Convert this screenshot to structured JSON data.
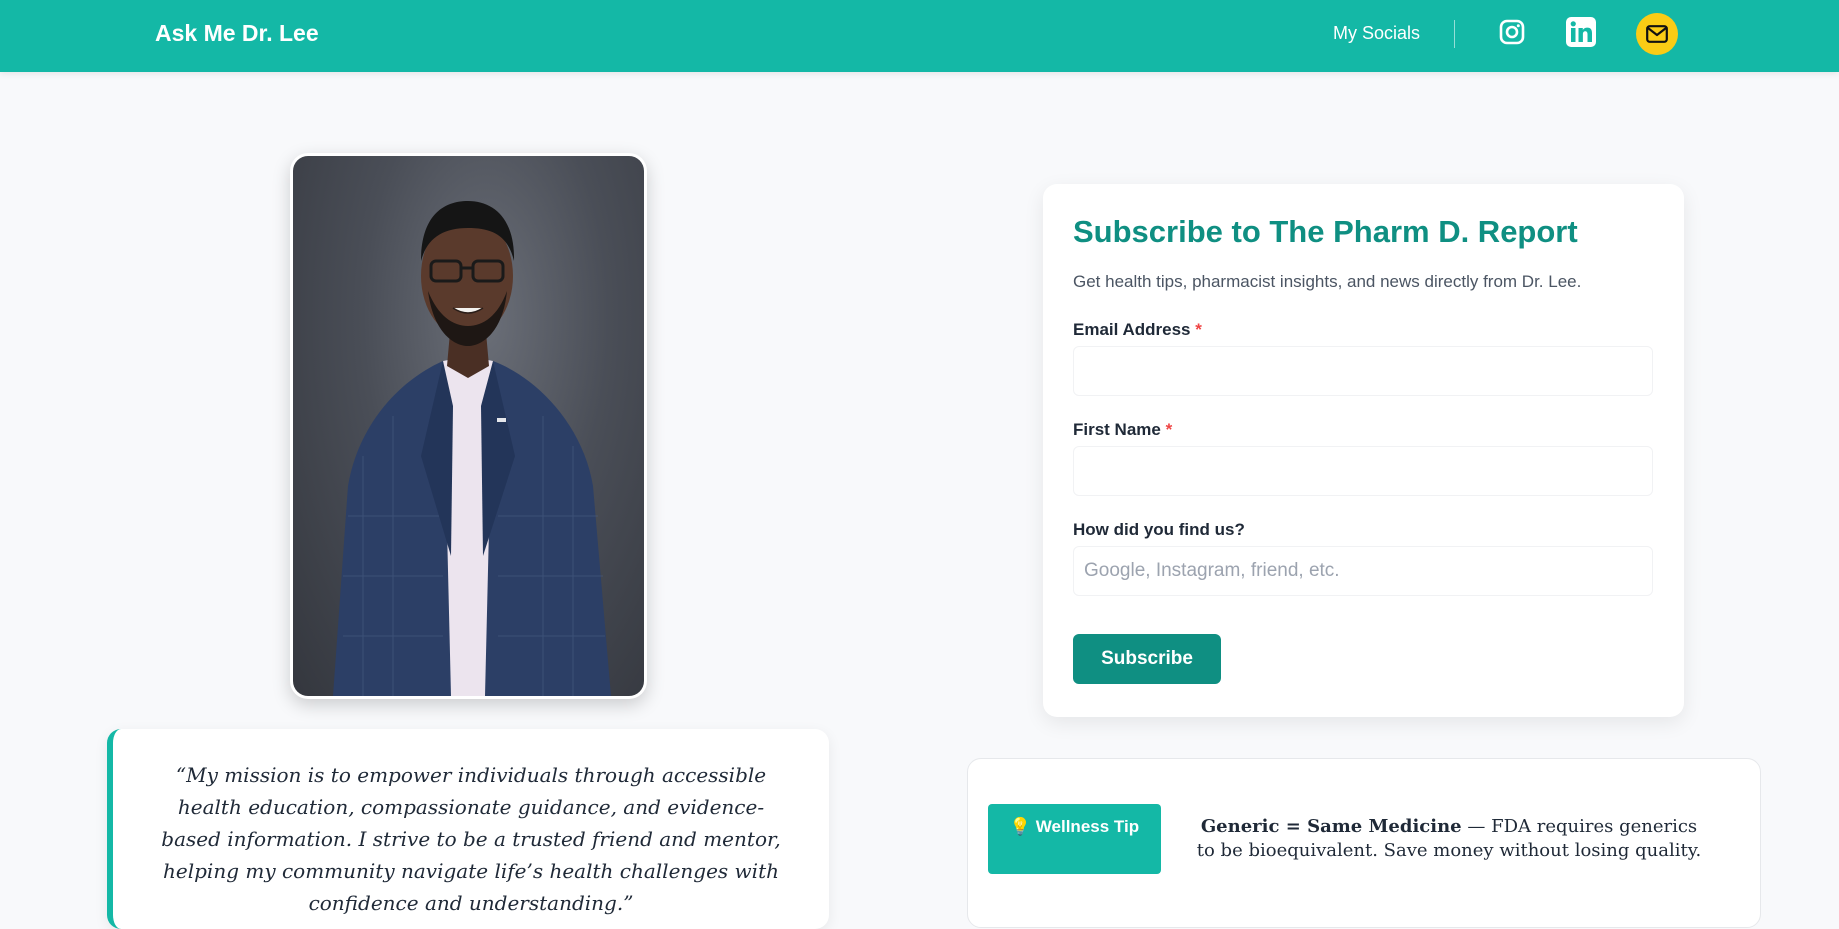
{
  "header": {
    "brand": "Ask Me Dr. Lee",
    "socials_label": "My Socials",
    "icons": [
      "instagram-icon",
      "linkedin-icon",
      "mail-icon"
    ],
    "accent_color": "#14b8a6",
    "mail_bg_color": "#facc15"
  },
  "profile": {
    "quote": "“My mission is to empower individuals through accessible health education, compassionate guidance, and evidence-based information. I strive to be a trusted friend and mentor, helping my community navigate life’s health challenges with confidence and understanding.”"
  },
  "subscribe": {
    "title": "Subscribe to The Pharm D. Report",
    "description": "Get health tips, pharmacist insights, and news directly from Dr. Lee.",
    "email_label": "Email Address",
    "email_value": "",
    "first_name_label": "First Name",
    "first_name_value": "",
    "required_mark": "*",
    "source_label": "How did you find us?",
    "source_placeholder": "Google, Instagram, friend, etc.",
    "button_label": "Subscribe",
    "title_color": "#0f8f82"
  },
  "wellness_tip": {
    "badge_icon": "💡",
    "badge_label": "Wellness Tip",
    "headline": "Generic = Same Medicine",
    "body": " — FDA requires generics to be bioequivalent. Save money without losing quality."
  }
}
